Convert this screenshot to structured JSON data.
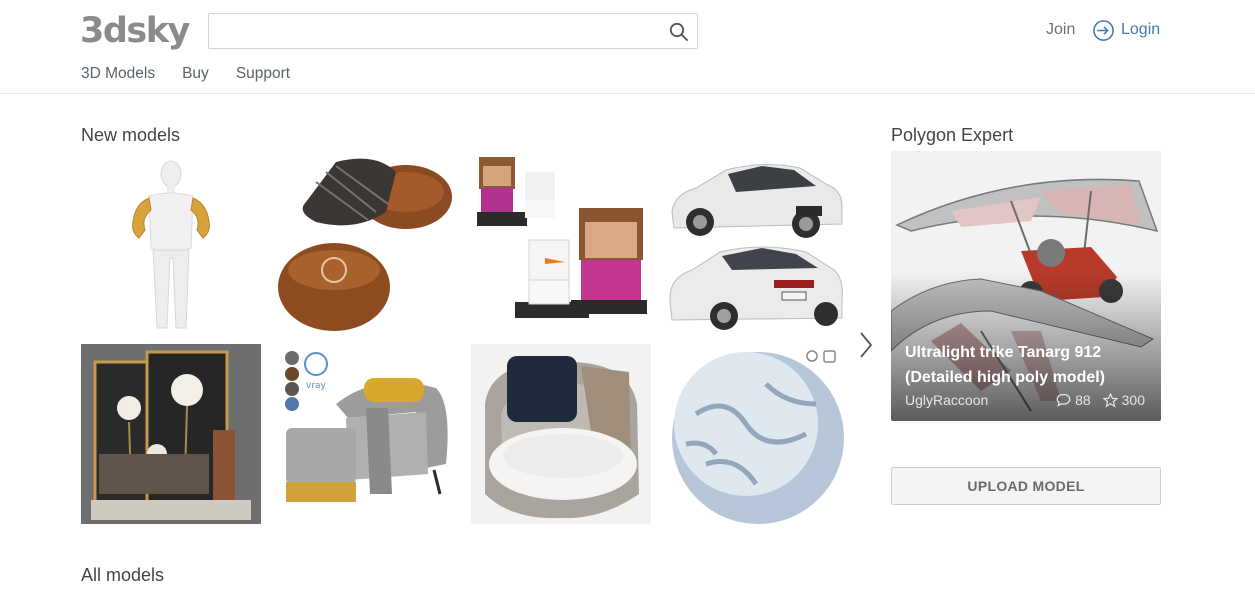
{
  "brand": {
    "logo_text": "3dsky"
  },
  "search": {
    "value": "",
    "placeholder": ""
  },
  "header": {
    "join_label": "Join",
    "login_label": "Login"
  },
  "nav": {
    "items": [
      "3D Models",
      "Buy",
      "Support"
    ]
  },
  "new_models": {
    "title": "New models",
    "items": [
      {
        "name": "white mannequin with gold arms"
      },
      {
        "name": "leather poufs with plaid throw"
      },
      {
        "name": "toy brick figures"
      },
      {
        "name": "white sedan car"
      },
      {
        "name": "framed flower wall decor set"
      },
      {
        "name": "grey armchair with yellow pillow and pouf"
      },
      {
        "name": "round lounge armchair with cushions"
      },
      {
        "name": "snow textured sphere material"
      }
    ]
  },
  "polygon_expert": {
    "title": "Polygon Expert",
    "model_title": "Ultralight trike Tanarg 912 (Detailed high poly model)",
    "author": "UglyRaccoon",
    "comments": "88",
    "stars": "300"
  },
  "upload": {
    "label": "UPLOAD MODEL"
  },
  "all_models": {
    "title": "All models"
  },
  "colors": {
    "accent": "#3d7ab8",
    "logo": "#8b8b8b",
    "text": "#454545"
  }
}
